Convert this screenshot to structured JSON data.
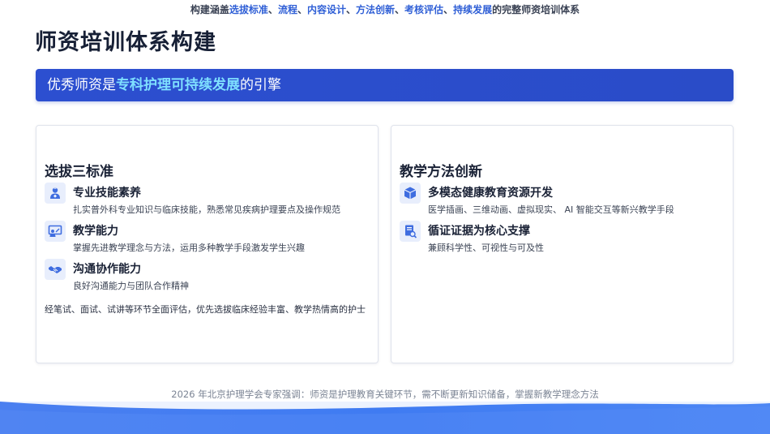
{
  "top_strip": {
    "prefix": "构建涵盖",
    "h1": "选拔标准",
    "s1": "、",
    "h2": "流程",
    "s2": "、",
    "h3": "内容设计",
    "s3": "、",
    "h4": "方法创新",
    "s4": "、",
    "h5": "考核评估",
    "s5": "、",
    "h6": "持续发展",
    "suffix": "的完整师资培训体系"
  },
  "page_title": "师资培训体系构建",
  "banner": {
    "prefix": "优秀师资是",
    "highlight": "专科护理可持续发展",
    "suffix": "的引擎"
  },
  "left_card": {
    "title": "选拔三标准",
    "items": [
      {
        "icon": "nurse-icon",
        "title": "专业技能素养",
        "desc": "扎实普外科专业知识与临床技能，熟悉常见疾病护理要点及操作规范"
      },
      {
        "icon": "teaching-icon",
        "title": "教学能力",
        "desc": "掌握先进教学理念与方法，运用多种教学手段激发学生兴趣"
      },
      {
        "icon": "handshake-icon",
        "title": "沟通协作能力",
        "desc": "良好沟通能力与团队合作精神"
      }
    ],
    "summary": "经笔试、面试、试讲等环节全面评估，优先选拔临床经验丰富、教学热情高的护士"
  },
  "right_card": {
    "title": "教学方法创新",
    "items": [
      {
        "icon": "cube-icon",
        "title": "多模态健康教育资源开发",
        "desc": "医学插画、三维动画、虚拟现实、 AI 智能交互等新兴教学手段"
      },
      {
        "icon": "evidence-icon",
        "title": "循证证据为核心支撑",
        "desc": "兼顾科学性、可视性与可及性"
      }
    ]
  },
  "footer": "2026 年北京护理学会专家强调：师资是护理教育关键环节，需不断更新知识储备，掌握新教学理念方法",
  "colors": {
    "banner": "#2c4fd0",
    "accent": "#2f5fd6",
    "highlight": "#7fe0ff",
    "icon": "#3f6de0"
  }
}
